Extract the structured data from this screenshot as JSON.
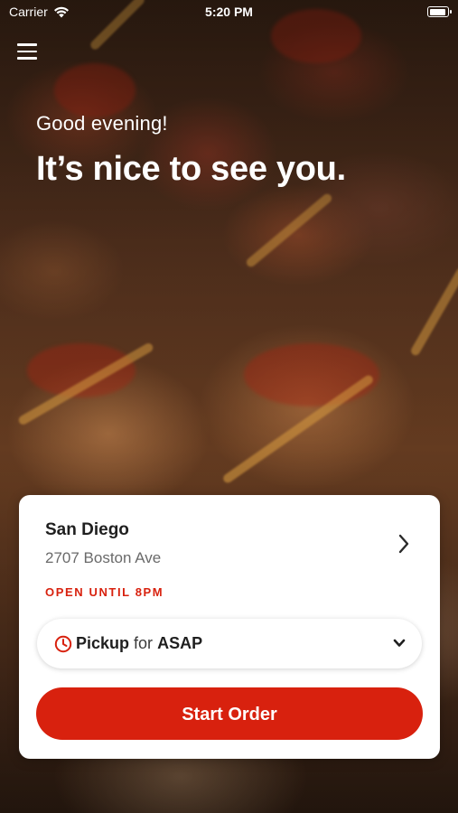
{
  "status_bar": {
    "carrier": "Carrier",
    "time": "5:20 PM",
    "wifi_icon": "wifi-icon",
    "battery_icon": "battery-icon"
  },
  "header": {
    "menu_icon": "hamburger-menu-icon",
    "greeting": "Good evening!",
    "headline": "It’s nice to see you."
  },
  "location_card": {
    "name": "San Diego",
    "address": "2707 Boston Ave",
    "hours": "OPEN UNTIL 8PM",
    "chevron_icon": "chevron-right-icon",
    "order_type": {
      "icon": "clock-icon",
      "mode": "Pickup",
      "connector": "for",
      "time": "ASAP",
      "dropdown_icon": "chevron-down-icon"
    },
    "start_button_label": "Start Order"
  },
  "colors": {
    "accent": "#d8210e",
    "card_background": "#ffffff",
    "text_primary": "#1f1f1f",
    "text_secondary": "#6a6a6a"
  }
}
